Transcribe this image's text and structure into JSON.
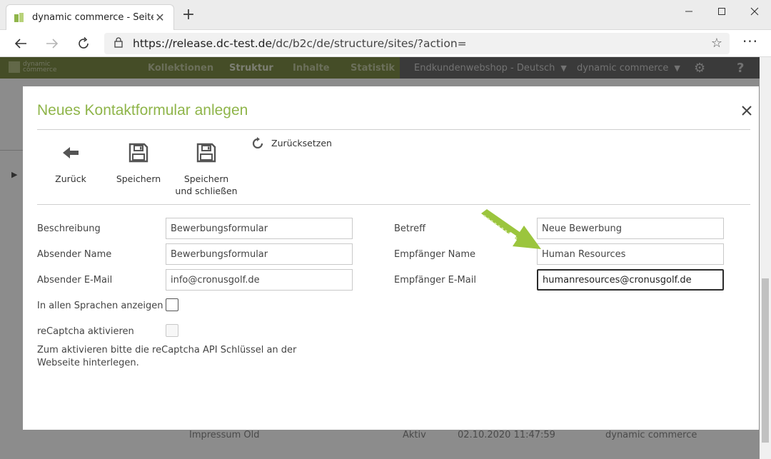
{
  "browser": {
    "tab_title": "dynamic commerce - Seiten",
    "url_host": "https://release.dc-test.de",
    "url_path": "/dc/b2c/de/structure/sites/?action="
  },
  "app": {
    "logo_line1": "dynamic",
    "logo_line2": "commerce",
    "nav": [
      "Kollektionen",
      "Struktur",
      "Inhalte",
      "Statistik"
    ],
    "shop_select": "Endkundenwebshop - Deutsch",
    "user_select": "dynamic commerce",
    "help": "?"
  },
  "background_row": {
    "name": "Impressum Old",
    "status": "Aktiv",
    "date": "02.10.2020 11:47:59",
    "author": "dynamic commerce"
  },
  "modal": {
    "title": "Neues Kontaktformular anlegen",
    "toolbar": {
      "back": "Zurück",
      "save": "Speichern",
      "save_close": "Speichern und schließen",
      "reset": "Zurücksetzen"
    },
    "fields": {
      "beschreibung_label": "Beschreibung",
      "beschreibung_value": "Bewerbungsformular",
      "absender_name_label": "Absender Name",
      "absender_name_value": "Bewerbungsformular",
      "absender_email_label": "Absender E-Mail",
      "absender_email_value": "info@cronusgolf.de",
      "sprachen_label": "In allen Sprachen anzeigen",
      "recaptcha_label": "reCaptcha aktivieren",
      "betreff_label": "Betreff",
      "betreff_value": "Neue Bewerbung",
      "empfaenger_name_label": "Empfänger Name",
      "empfaenger_name_value": "Human Resources",
      "empfaenger_email_label": "Empfänger E-Mail",
      "empfaenger_email_value": "humanresources@cronusgolf.de"
    },
    "note": "Zum aktivieren bitte die reCaptcha API Schlüssel an der Webseite hinterlegen."
  },
  "colors": {
    "accent_green": "#8fb54a",
    "header_green": "#7e8c47",
    "arrow_green": "#9bc53d"
  }
}
